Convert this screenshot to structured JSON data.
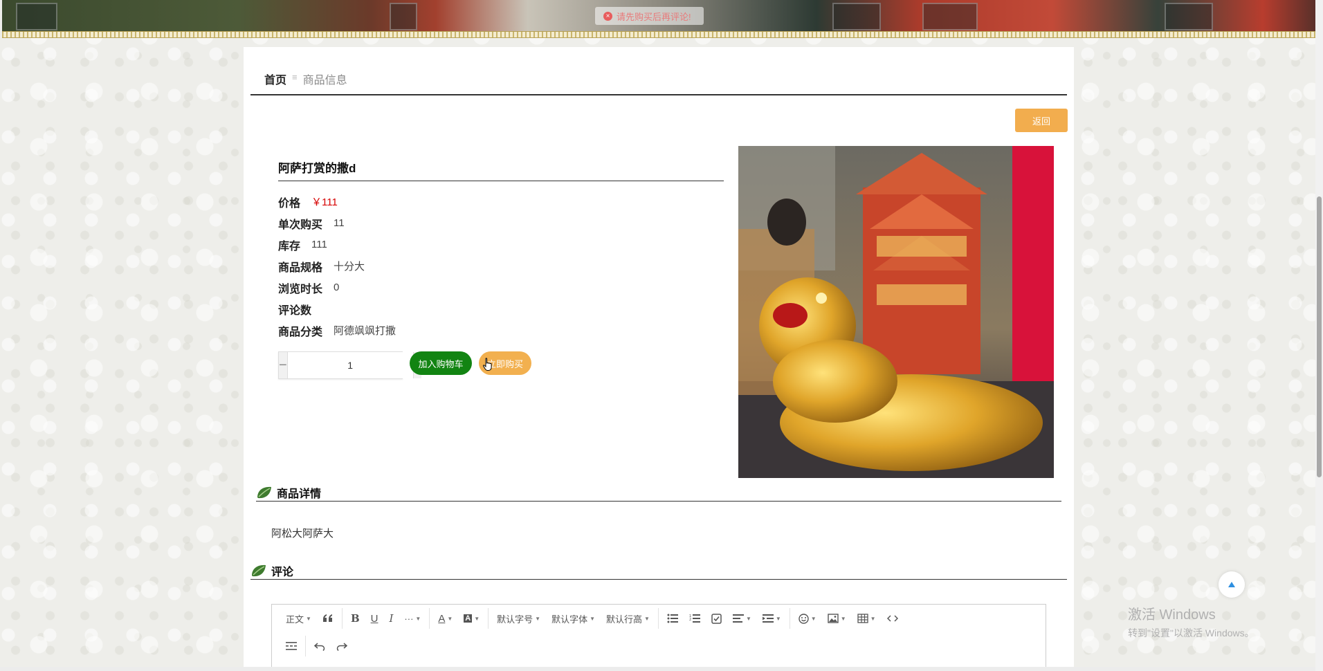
{
  "banner": {
    "message": "请先购买后再评论!"
  },
  "breadcrumb": {
    "home": "首页",
    "separator": "≡",
    "current": "商品信息"
  },
  "actions": {
    "back": "返回",
    "add_to_cart": "加入购物车",
    "buy_now": "立即购买"
  },
  "product": {
    "title": "阿萨打赏的撒d",
    "fields": [
      {
        "label": "价格",
        "value": "￥111"
      },
      {
        "label": "单次购买",
        "value": "11"
      },
      {
        "label": "库存",
        "value": "111"
      },
      {
        "label": "商品规格",
        "value": "十分大"
      },
      {
        "label": "浏览时长",
        "value": "0"
      },
      {
        "label": "评论数",
        "value": ""
      },
      {
        "label": "商品分类",
        "value": "阿德飒飒打撒"
      }
    ],
    "quantity": "1",
    "image_alt": "golden dragon boat figurine",
    "colors": {
      "price": "#d60000",
      "cart_button": "#128412",
      "buy_button": "#f2b04f",
      "back_button": "#f2ad4e"
    }
  },
  "sections": {
    "detail_title": "商品详情",
    "detail_text": "阿松大阿萨大",
    "comments_title": "评论"
  },
  "editor": {
    "paragraph": "正文",
    "font_size": "默认字号",
    "font_family": "默认字体",
    "line_height": "默认行高",
    "icons": [
      "quote-icon",
      "bold-icon",
      "underline-icon",
      "italic-icon",
      "more-icon",
      "font-color-icon",
      "bg-color-icon",
      "bulleted-list-icon",
      "numbered-list-icon",
      "todo-icon",
      "align-icon",
      "indent-icon",
      "emoji-icon",
      "image-icon",
      "table-icon",
      "code-icon",
      "divider-icon",
      "undo-icon",
      "redo-icon"
    ]
  },
  "watermark": {
    "line1": "激活 Windows",
    "line2": "转到\"设置\"以激活 Windows。"
  }
}
